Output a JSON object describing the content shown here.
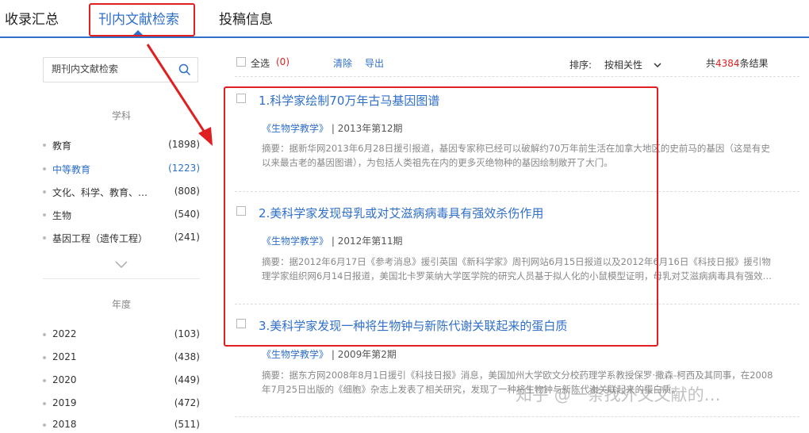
{
  "tabs": [
    {
      "label": "收录汇总"
    },
    {
      "label": "刊内文献检索"
    },
    {
      "label": "投稿信息"
    }
  ],
  "search": {
    "placeholder": "期刊内文献检索"
  },
  "facets": {
    "subject": {
      "title": "学科",
      "items": [
        {
          "name": "教育",
          "count": "(1898)"
        },
        {
          "name": "中等教育",
          "count": "(1223)"
        },
        {
          "name": "文化、科学、教育、体育",
          "count": "(808)"
        },
        {
          "name": "生物",
          "count": "(540)"
        },
        {
          "name": "基因工程（遗传工程）",
          "count": "(241)"
        }
      ]
    },
    "year": {
      "title": "年度",
      "items": [
        {
          "name": "2022",
          "count": "(103)"
        },
        {
          "name": "2021",
          "count": "(438)"
        },
        {
          "name": "2020",
          "count": "(449)"
        },
        {
          "name": "2019",
          "count": "(472)"
        },
        {
          "name": "2018",
          "count": "(511)"
        }
      ]
    }
  },
  "toolbar": {
    "select_all": "全选",
    "selected_count": "(0)",
    "clear": "清除",
    "export": "导出",
    "sort_label": "排序:",
    "sort_value": "按相关性",
    "total_prefix": "共",
    "total_count": "4384",
    "total_suffix": "条结果"
  },
  "results": [
    {
      "title": "1.科学家绘制70万年古马基因图谱",
      "journal": "《生物学教学》",
      "issue": "| 2013年第12期",
      "abstract": "摘要：据新华网2013年6月28日援引报道，基因专家称已经可以破解约70万年前生活在加拿大地区的史前马的基因（这是有史以来最古老的基因图谱），为包括人类祖先在内的更多灭绝物种的基因绘制敞开了大门。"
    },
    {
      "title": "2.美科学家发现母乳或对艾滋病病毒具有强效杀伤作用",
      "journal": "《生物学教学》",
      "issue": "| 2012年第11期",
      "abstract": "摘要：据2012年6月17日《参考消息》援引英国《新科学家》周刊网站6月15日报道以及2012年6月16日《科技日报》援引物理学家组织网6月14日报道，美国北卡罗莱纳大学医学院的研究人员基于拟人化的小鼠模型证明，母乳对艾滋病病毒具有强效杀伤作用。"
    },
    {
      "title": "3.美科学家发现一种将生物钟与新陈代谢关联起来的蛋白质",
      "journal": "《生物学教学》",
      "issue": "| 2009年第2期",
      "abstract": "摘要：据东方网2008年8月1日援引《科技日报》消息，美国加州大学欧文分校药理学系教授保罗·撒森-柯西及其同事，在2008年7月25日出版的《细胞》杂志上发表了相关研究，发现了一种将生物钟与新陈代谢关联起来的蛋白质。"
    }
  ],
  "watermark": "知乎 @一条找外文文献的…",
  "colors": {
    "accent": "#2f6fc8",
    "highlight": "#e02020"
  }
}
